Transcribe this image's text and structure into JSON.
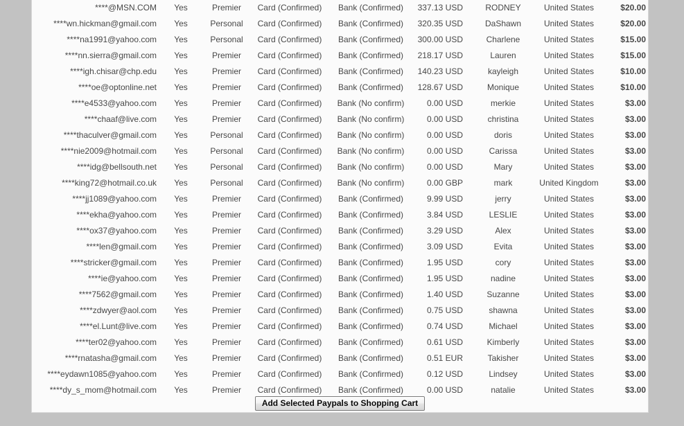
{
  "page": {
    "background_color": "#c2c2c2",
    "panel_color": "#fbfbfb"
  },
  "table": {
    "columns": [
      "email",
      "verified",
      "account_type",
      "card_status",
      "bank_status",
      "balance",
      "first_name",
      "country",
      "price",
      "select"
    ],
    "rows": [
      {
        "email": "****@MSN.COM",
        "verified": "Yes",
        "account_type": "Premier",
        "card_status": "Card (Confirmed)",
        "bank_status": "Bank (Confirmed)",
        "balance": "337.13 USD",
        "first_name": "RODNEY",
        "country": "United States",
        "price": "$20.00"
      },
      {
        "email": "****wn.hickman@gmail.com",
        "verified": "Yes",
        "account_type": "Personal",
        "card_status": "Card (Confirmed)",
        "bank_status": "Bank (Confirmed)",
        "balance": "320.35 USD",
        "first_name": "DaShawn",
        "country": "United States",
        "price": "$20.00"
      },
      {
        "email": "****na1991@yahoo.com",
        "verified": "Yes",
        "account_type": "Personal",
        "card_status": "Card (Confirmed)",
        "bank_status": "Bank (Confirmed)",
        "balance": "300.00 USD",
        "first_name": "Charlene",
        "country": "United States",
        "price": "$15.00"
      },
      {
        "email": "****nn.sierra@gmail.com",
        "verified": "Yes",
        "account_type": "Premier",
        "card_status": "Card (Confirmed)",
        "bank_status": "Bank (Confirmed)",
        "balance": "218.17 USD",
        "first_name": "Lauren",
        "country": "United States",
        "price": "$15.00"
      },
      {
        "email": "****igh.chisar@chp.edu",
        "verified": "Yes",
        "account_type": "Premier",
        "card_status": "Card (Confirmed)",
        "bank_status": "Bank (Confirmed)",
        "balance": "140.23 USD",
        "first_name": "kayleigh",
        "country": "United States",
        "price": "$10.00"
      },
      {
        "email": "****oe@optonline.net",
        "verified": "Yes",
        "account_type": "Premier",
        "card_status": "Card (Confirmed)",
        "bank_status": "Bank (Confirmed)",
        "balance": "128.67 USD",
        "first_name": "Monique",
        "country": "United States",
        "price": "$10.00"
      },
      {
        "email": "****e4533@yahoo.com",
        "verified": "Yes",
        "account_type": "Premier",
        "card_status": "Card (Confirmed)",
        "bank_status": "Bank (No confirm)",
        "balance": "0.00 USD",
        "first_name": "merkie",
        "country": "United States",
        "price": "$3.00"
      },
      {
        "email": "****chaaf@live.com",
        "verified": "Yes",
        "account_type": "Premier",
        "card_status": "Card (Confirmed)",
        "bank_status": "Bank (No confirm)",
        "balance": "0.00 USD",
        "first_name": "christina",
        "country": "United States",
        "price": "$3.00"
      },
      {
        "email": "****thaculver@gmail.com",
        "verified": "Yes",
        "account_type": "Personal",
        "card_status": "Card (Confirmed)",
        "bank_status": "Bank (No confirm)",
        "balance": "0.00 USD",
        "first_name": "doris",
        "country": "United States",
        "price": "$3.00"
      },
      {
        "email": "****nie2009@hotmail.com",
        "verified": "Yes",
        "account_type": "Personal",
        "card_status": "Card (Confirmed)",
        "bank_status": "Bank (No confirm)",
        "balance": "0.00 USD",
        "first_name": "Carissa",
        "country": "United States",
        "price": "$3.00"
      },
      {
        "email": "****idg@bellsouth.net",
        "verified": "Yes",
        "account_type": "Personal",
        "card_status": "Card (Confirmed)",
        "bank_status": "Bank (No confirm)",
        "balance": "0.00 USD",
        "first_name": "Mary",
        "country": "United States",
        "price": "$3.00"
      },
      {
        "email": "****king72@hotmail.co.uk",
        "verified": "Yes",
        "account_type": "Personal",
        "card_status": "Card (Confirmed)",
        "bank_status": "Bank (No confirm)",
        "balance": "0.00 GBP",
        "first_name": "mark",
        "country": "United Kingdom",
        "price": "$3.00"
      },
      {
        "email": "****jj1089@yahoo.com",
        "verified": "Yes",
        "account_type": "Premier",
        "card_status": "Card (Confirmed)",
        "bank_status": "Bank (Confirmed)",
        "balance": "9.99 USD",
        "first_name": "jerry",
        "country": "United States",
        "price": "$3.00"
      },
      {
        "email": "****ekha@yahoo.com",
        "verified": "Yes",
        "account_type": "Premier",
        "card_status": "Card (Confirmed)",
        "bank_status": "Bank (Confirmed)",
        "balance": "3.84 USD",
        "first_name": "LESLIE",
        "country": "United States",
        "price": "$3.00"
      },
      {
        "email": "****ox37@yahoo.com",
        "verified": "Yes",
        "account_type": "Premier",
        "card_status": "Card (Confirmed)",
        "bank_status": "Bank (Confirmed)",
        "balance": "3.29 USD",
        "first_name": "Alex",
        "country": "United States",
        "price": "$3.00"
      },
      {
        "email": "****len@gmail.com",
        "verified": "Yes",
        "account_type": "Premier",
        "card_status": "Card (Confirmed)",
        "bank_status": "Bank (Confirmed)",
        "balance": "3.09 USD",
        "first_name": "Evita",
        "country": "United States",
        "price": "$3.00"
      },
      {
        "email": "****stricker@gmail.com",
        "verified": "Yes",
        "account_type": "Premier",
        "card_status": "Card (Confirmed)",
        "bank_status": "Bank (Confirmed)",
        "balance": "1.95 USD",
        "first_name": "cory",
        "country": "United States",
        "price": "$3.00"
      },
      {
        "email": "****ie@yahoo.com",
        "verified": "Yes",
        "account_type": "Premier",
        "card_status": "Card (Confirmed)",
        "bank_status": "Bank (Confirmed)",
        "balance": "1.95 USD",
        "first_name": "nadine",
        "country": "United States",
        "price": "$3.00"
      },
      {
        "email": "****7562@gmail.com",
        "verified": "Yes",
        "account_type": "Premier",
        "card_status": "Card (Confirmed)",
        "bank_status": "Bank (Confirmed)",
        "balance": "1.40 USD",
        "first_name": "Suzanne",
        "country": "United States",
        "price": "$3.00"
      },
      {
        "email": "****zdwyer@aol.com",
        "verified": "Yes",
        "account_type": "Premier",
        "card_status": "Card (Confirmed)",
        "bank_status": "Bank (Confirmed)",
        "balance": "0.75 USD",
        "first_name": "shawna",
        "country": "United States",
        "price": "$3.00"
      },
      {
        "email": "****el.Lunt@live.com",
        "verified": "Yes",
        "account_type": "Premier",
        "card_status": "Card (Confirmed)",
        "bank_status": "Bank (Confirmed)",
        "balance": "0.74 USD",
        "first_name": "Michael",
        "country": "United States",
        "price": "$3.00"
      },
      {
        "email": "****ter02@yahoo.com",
        "verified": "Yes",
        "account_type": "Premier",
        "card_status": "Card (Confirmed)",
        "bank_status": "Bank (Confirmed)",
        "balance": "0.61 USD",
        "first_name": "Kimberly",
        "country": "United States",
        "price": "$3.00"
      },
      {
        "email": "****rnatasha@gmail.com",
        "verified": "Yes",
        "account_type": "Premier",
        "card_status": "Card (Confirmed)",
        "bank_status": "Bank (Confirmed)",
        "balance": "0.51 EUR",
        "first_name": "Takisher",
        "country": "United States",
        "price": "$3.00"
      },
      {
        "email": "****eydawn1085@yahoo.com",
        "verified": "Yes",
        "account_type": "Premier",
        "card_status": "Card (Confirmed)",
        "bank_status": "Bank (Confirmed)",
        "balance": "0.12 USD",
        "first_name": "Lindsey",
        "country": "United States",
        "price": "$3.00"
      },
      {
        "email": "****dy_s_mom@hotmail.com",
        "verified": "Yes",
        "account_type": "Premier",
        "card_status": "Card (Confirmed)",
        "bank_status": "Bank (Confirmed)",
        "balance": "0.00 USD",
        "first_name": "natalie",
        "country": "United States",
        "price": "$3.00"
      }
    ]
  },
  "footer": {
    "add_to_cart_label": "Add Selected Paypals to Shopping Cart"
  }
}
